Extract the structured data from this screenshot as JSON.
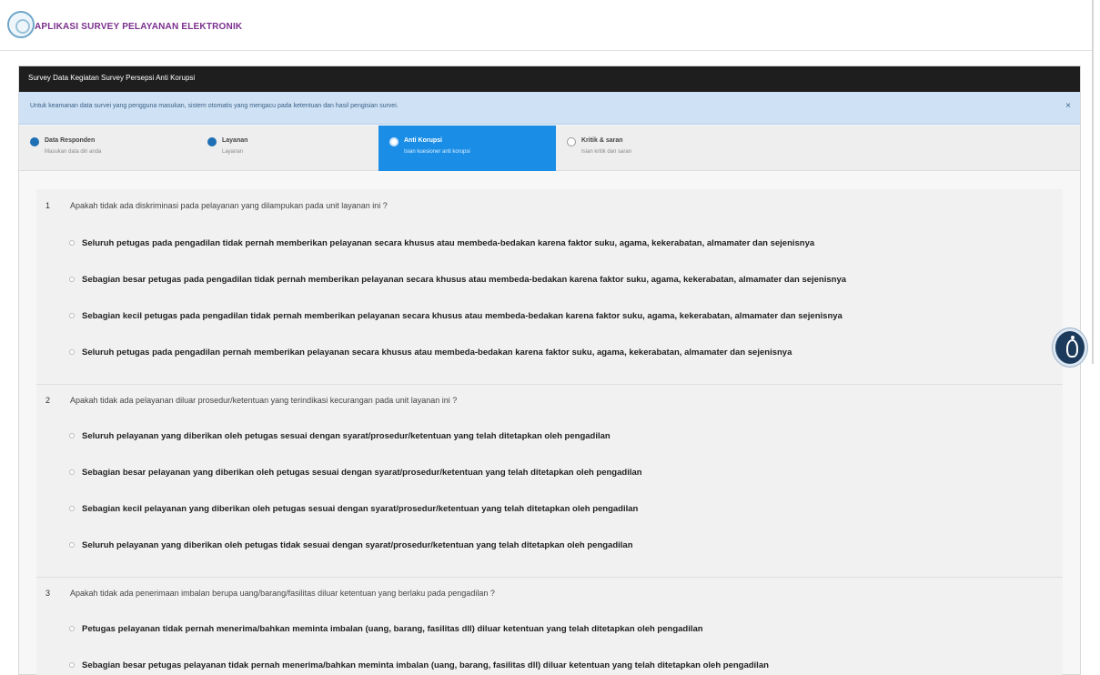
{
  "header": {
    "app_title": "APLIKASI SURVEY PELAYANAN ELEKTRONIK"
  },
  "survey": {
    "title": "Survey Data Kegiatan Survey Persepsi Anti Korupsi"
  },
  "info": {
    "text": "Untuk keamanan data survei yang pengguna masukan, sistem otomatis yang mengacu pada ketentuan dan hasil pengisian survei."
  },
  "steps": [
    {
      "title": "Data Responden",
      "sub": "Masukan data diri anda",
      "state": "done"
    },
    {
      "title": "Layanan",
      "sub": "Layanan",
      "state": "done"
    },
    {
      "title": "Anti Korupsi",
      "sub": "Isian kuesioner anti korupsi",
      "state": "active"
    },
    {
      "title": "Kritik & saran",
      "sub": "Isian kritik dan saran",
      "state": "todo"
    }
  ],
  "questions": [
    {
      "number": "1",
      "text": "Apakah tidak ada diskriminasi pada pelayanan yang dilampukan pada unit layanan ini ?",
      "options": [
        "Seluruh petugas pada pengadilan tidak pernah memberikan pelayanan secara khusus atau membeda-bedakan karena faktor suku, agama, kekerabatan, almamater dan sejenisnya",
        "Sebagian besar petugas pada pengadilan tidak pernah memberikan pelayanan secara khusus atau membeda-bedakan karena faktor suku, agama, kekerabatan, almamater dan sejenisnya",
        "Sebagian kecil petugas pada pengadilan tidak pernah memberikan pelayanan secara khusus atau membeda-bedakan karena faktor suku, agama, kekerabatan, almamater dan sejenisnya",
        "Seluruh petugas pada pengadilan pernah memberikan pelayanan secara khusus atau membeda-bedakan karena faktor suku, agama, kekerabatan, almamater dan sejenisnya"
      ]
    },
    {
      "number": "2",
      "text": "Apakah tidak ada pelayanan diluar prosedur/ketentuan yang terindikasi kecurangan pada unit layanan ini ?",
      "options": [
        "Seluruh pelayanan yang diberikan oleh petugas sesuai dengan syarat/prosedur/ketentuan yang telah ditetapkan oleh pengadilan",
        "Sebagian besar pelayanan yang diberikan oleh petugas sesuai dengan syarat/prosedur/ketentuan yang telah ditetapkan oleh pengadilan",
        "Sebagian kecil pelayanan yang diberikan oleh petugas sesuai dengan syarat/prosedur/ketentuan yang telah ditetapkan oleh pengadilan",
        "Seluruh pelayanan yang diberikan oleh petugas tidak sesuai dengan syarat/prosedur/ketentuan yang telah ditetapkan oleh pengadilan"
      ]
    },
    {
      "number": "3",
      "text": "Apakah tidak ada penerimaan imbalan berupa uang/barang/fasilitas diluar ketentuan yang berlaku pada pengadilan ?",
      "options": [
        "Petugas pelayanan tidak pernah menerima/bahkan meminta imbalan (uang, barang, fasilitas dll) diluar ketentuan yang telah ditetapkan oleh pengadilan",
        "Sebagian besar petugas pelayanan tidak pernah menerima/bahkan meminta imbalan (uang, barang, fasilitas dll) diluar ketentuan yang telah ditetapkan oleh pengadilan"
      ]
    }
  ],
  "icons": {
    "logo": "court-logo-icon",
    "accessibility": "accessibility-icon",
    "close": "close-icon"
  },
  "colors": {
    "accent": "#1a8ee6",
    "survey_bar": "#1e1e1e",
    "info_bg": "#cfe2f5",
    "title": "#7b2f8e"
  }
}
